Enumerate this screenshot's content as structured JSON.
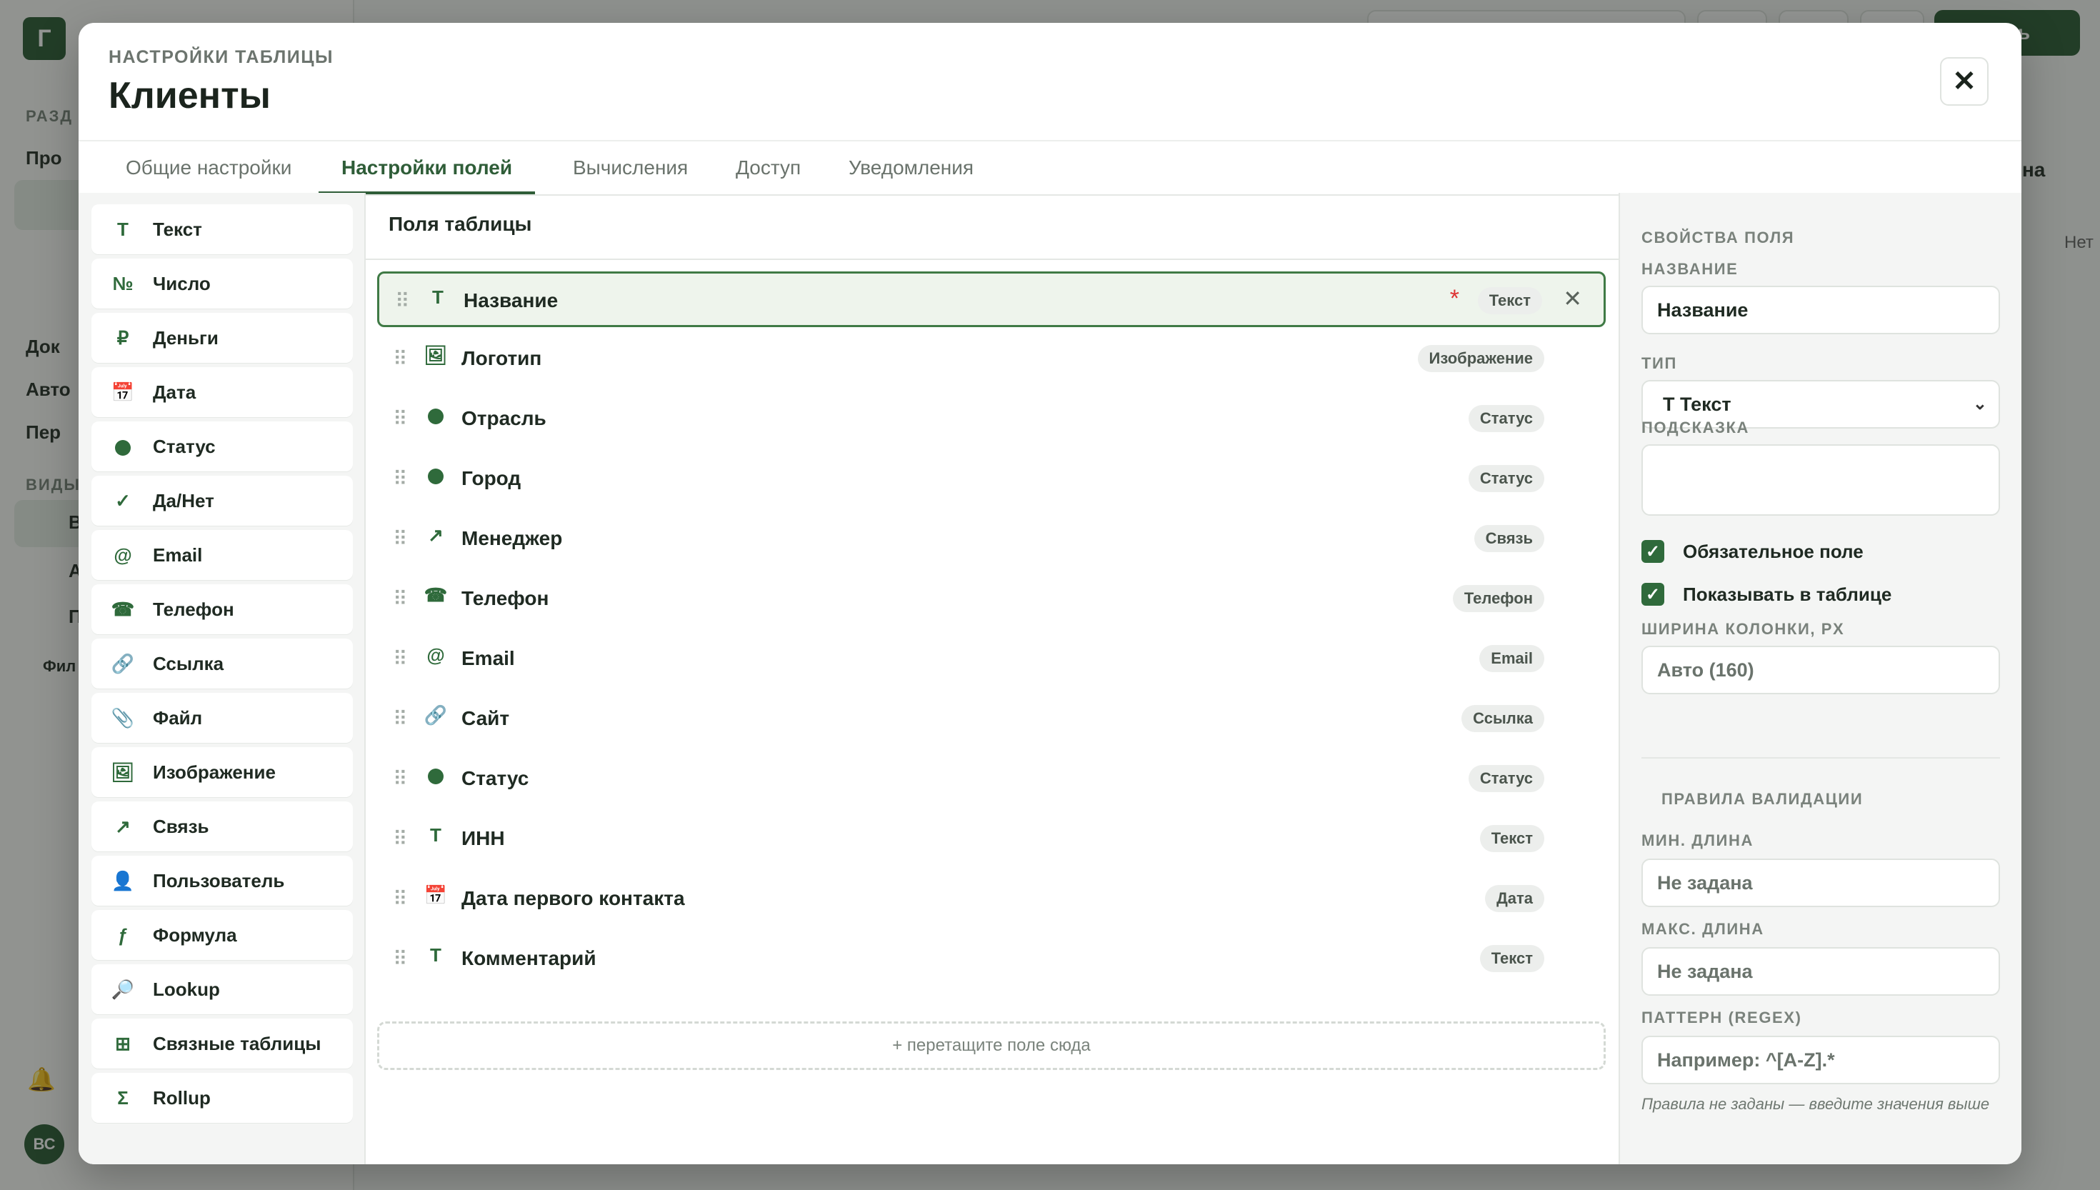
{
  "background": {
    "logo_letter": "Г",
    "sidebar_fragments": [
      "РАЗД",
      "Про",
      "Док",
      "Авто",
      "Пер",
      "ВИДЫ",
      "В",
      "А",
      "П",
      "Фил"
    ],
    "create_button": "дать",
    "column_header": "щина",
    "cell_value": "Нет",
    "avatar_initials": "ВС"
  },
  "modal": {
    "kicker": "НАСТРОЙКИ ТАБЛИЦЫ",
    "title": "Клиенты",
    "close_icon": "✕",
    "tabs": [
      {
        "label": "Общие настройки",
        "active": false
      },
      {
        "label": "Настройки полей",
        "active": true
      },
      {
        "label": "Вычисления",
        "active": false
      },
      {
        "label": "Доступ",
        "active": false
      },
      {
        "label": "Уведомления",
        "active": false
      }
    ]
  },
  "palette": [
    {
      "icon": "T",
      "icon_name": "text-icon",
      "label": "Текст"
    },
    {
      "icon": "№",
      "icon_name": "number-icon",
      "label": "Число"
    },
    {
      "icon": "₽",
      "icon_name": "ruble-icon",
      "label": "Деньги"
    },
    {
      "icon": "📅",
      "icon_name": "calendar-icon",
      "label": "Дата"
    },
    {
      "icon": "●",
      "icon_name": "status-dot-icon",
      "label": "Статус"
    },
    {
      "icon": "✓",
      "icon_name": "check-icon",
      "label": "Да/Нет"
    },
    {
      "icon": "@",
      "icon_name": "at-icon",
      "label": "Email"
    },
    {
      "icon": "☎",
      "icon_name": "phone-icon",
      "label": "Телефон"
    },
    {
      "icon": "🔗",
      "icon_name": "link-icon",
      "label": "Ссылка"
    },
    {
      "icon": "📎",
      "icon_name": "paperclip-icon",
      "label": "Файл"
    },
    {
      "icon": "🖼",
      "icon_name": "image-icon",
      "label": "Изображение"
    },
    {
      "icon": "↗",
      "icon_name": "relation-arrow-icon",
      "label": "Связь"
    },
    {
      "icon": "👤",
      "icon_name": "user-icon",
      "label": "Пользователь"
    },
    {
      "icon": "ƒ",
      "icon_name": "formula-icon",
      "label": "Формула"
    },
    {
      "icon": "🔎",
      "icon_name": "lookup-icon",
      "label": "Lookup"
    },
    {
      "icon": "⊞",
      "icon_name": "grid-icon",
      "label": "Связные таблицы"
    },
    {
      "icon": "Σ",
      "icon_name": "sigma-icon",
      "label": "Rollup"
    }
  ],
  "fields_panel": {
    "title": "Поля таблицы",
    "count": "12",
    "dropzone": "+ перетащите поле сюда",
    "fields": [
      {
        "icon": "T",
        "icon_name": "text-icon",
        "name": "Название",
        "type": "Текст",
        "required": true,
        "selected": true
      },
      {
        "icon": "🖼",
        "icon_name": "image-icon",
        "name": "Логотип",
        "type": "Изображение"
      },
      {
        "icon": "●",
        "icon_name": "status-dot-icon",
        "name": "Отрасль",
        "type": "Статус"
      },
      {
        "icon": "●",
        "icon_name": "status-dot-icon",
        "name": "Город",
        "type": "Статус"
      },
      {
        "icon": "↗",
        "icon_name": "relation-arrow-icon",
        "name": "Менеджер",
        "type": "Связь"
      },
      {
        "icon": "☎",
        "icon_name": "phone-icon",
        "name": "Телефон",
        "type": "Телефон"
      },
      {
        "icon": "@",
        "icon_name": "at-icon",
        "name": "Email",
        "type": "Email"
      },
      {
        "icon": "🔗",
        "icon_name": "link-icon",
        "name": "Сайт",
        "type": "Ссылка"
      },
      {
        "icon": "●",
        "icon_name": "status-dot-icon",
        "name": "Статус",
        "type": "Статус"
      },
      {
        "icon": "T",
        "icon_name": "text-icon",
        "name": "ИНН",
        "type": "Текст"
      },
      {
        "icon": "📅",
        "icon_name": "calendar-icon",
        "name": "Дата первого контакта",
        "type": "Дата"
      },
      {
        "icon": "T",
        "icon_name": "text-icon",
        "name": "Комментарий",
        "type": "Текст"
      }
    ]
  },
  "properties": {
    "section_title": "СВОЙСТВА ПОЛЯ",
    "name_label": "НАЗВАНИЕ",
    "name_value": "Название",
    "type_label": "ТИП",
    "type_value": "T Текст",
    "hint_label": "ПОДСКАЗКА",
    "hint_value": "",
    "required_label": "Обязательное поле",
    "required_checked": true,
    "show_label": "Показывать в таблице",
    "show_checked": true,
    "width_label": "ШИРИНА КОЛОНКИ, PX",
    "width_placeholder": "Авто (160)",
    "validation_title": "ПРАВИЛА ВАЛИДАЦИИ",
    "min_label": "МИН. ДЛИНА",
    "min_placeholder": "Не задана",
    "max_label": "МАКС. ДЛИНА",
    "max_placeholder": "Не задана",
    "pattern_label": "ПАТТЕРН (REGEX)",
    "pattern_placeholder": "Например: ^[A-Z].*",
    "note": "Правила не заданы — введите значения выше"
  },
  "colors": {
    "accent": "#2f5d38",
    "selected_row_bg": "#eef4ec",
    "required_marker": "#dd3333"
  }
}
